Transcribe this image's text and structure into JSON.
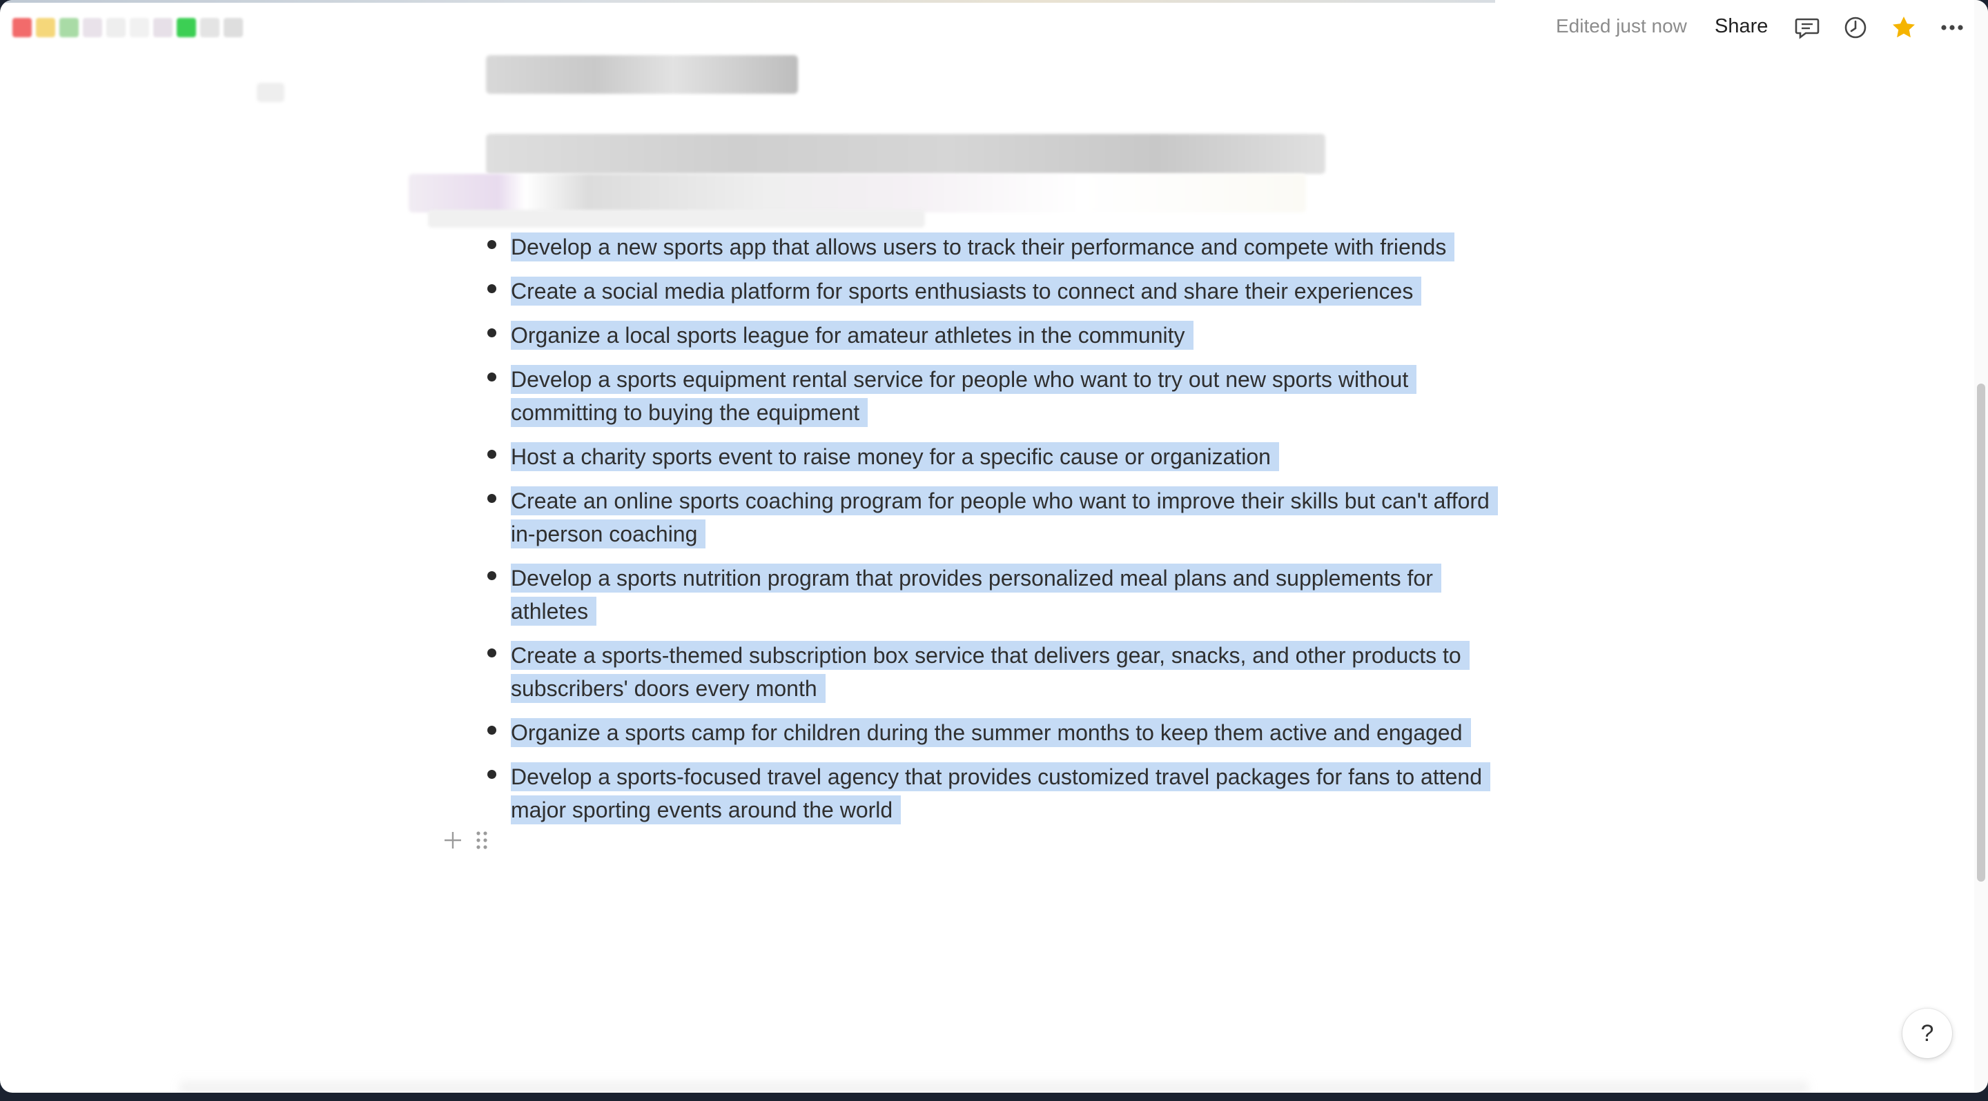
{
  "header": {
    "status": "Edited just now",
    "share_label": "Share",
    "icons": [
      "comment-icon",
      "history-clock-icon",
      "favorite-star-icon",
      "more-icon"
    ],
    "favorite_color": "#f5b400"
  },
  "list": {
    "highlight_color": "#c5dbf5",
    "items": [
      {
        "text": "Develop a new sports app that allows users to track their performance and compete with friends"
      },
      {
        "text": "Create a social media platform for sports enthusiasts to connect and share their experiences"
      },
      {
        "text": "Organize a local sports league for amateur athletes in the community"
      },
      {
        "text": "Develop a sports equipment rental service for people who want to try out new sports without committing to buying the equipment"
      },
      {
        "text": "Host a charity sports event to raise money for a specific cause or organization"
      },
      {
        "text": "Create an online sports coaching program for people who want to improve their skills but can't afford in-person coaching"
      },
      {
        "text": "Develop a sports nutrition program that provides personalized meal plans and supplements for athletes"
      },
      {
        "text": "Create a sports-themed subscription box service that delivers gear, snacks, and other products to subscribers' doors every month"
      },
      {
        "text": "Organize a sports camp for children during the summer months to keep them active and engaged"
      },
      {
        "text": "Develop a sports-focused travel agency that provides customized travel packages for fans to attend major sporting events around the world"
      }
    ]
  },
  "help": {
    "label": "?"
  }
}
